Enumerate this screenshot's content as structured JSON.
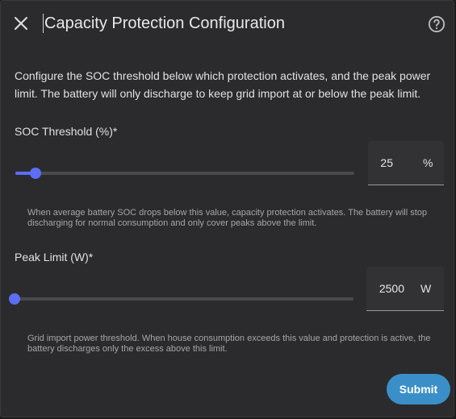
{
  "dialog": {
    "title": "Capacity Protection Configuration",
    "description": "Configure the SOC threshold below which protection activates, and the peak power limit. The battery will only discharge to keep grid import at or below the peak limit.",
    "close_icon": "close-icon",
    "help_icon": "help-circle-icon"
  },
  "soc": {
    "label": "SOC Threshold (%)*",
    "value": "25",
    "unit": "%",
    "slider_fraction": 0.06,
    "helper": "When average battery SOC drops below this value, capacity protection activates. The battery will stop discharging for normal consumption and only cover peaks above the limit."
  },
  "peak": {
    "label": "Peak Limit (W)*",
    "value": "2500",
    "unit": "W",
    "slider_fraction": 0.0,
    "helper": "Grid import power threshold. When house consumption exceeds this value and protection is active, the battery discharges only the excess above this limit."
  },
  "actions": {
    "submit_label": "Submit"
  },
  "colors": {
    "accent": "#5b6ef5",
    "submit": "#3a8fc8",
    "background": "#2b2b2d"
  }
}
